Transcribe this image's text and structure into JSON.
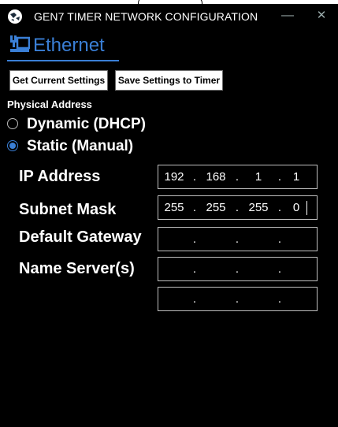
{
  "window": {
    "title": "GEN7 TIMER NETWORK CONFIGURATION",
    "minimize_glyph": "—",
    "close_glyph": "✕"
  },
  "tab": {
    "label": "Ethernet",
    "icon": "ethernet-network-icon"
  },
  "toolbar": {
    "get_label": "Get Current Settings",
    "save_label": "Save Settings to Timer"
  },
  "physical_address": {
    "label": "Physical Address",
    "options": [
      {
        "label": "Dynamic (DHCP)",
        "checked": false
      },
      {
        "label": "Static (Manual)",
        "checked": true
      }
    ]
  },
  "fields": {
    "ip": {
      "label": "IP Address",
      "octets": [
        "192",
        "168",
        "1",
        "1"
      ]
    },
    "subnet": {
      "label": "Subnet Mask",
      "octets": [
        "255",
        "255",
        "255",
        "0"
      ]
    },
    "gateway": {
      "label": "Default Gateway",
      "octets": [
        "",
        "",
        "",
        ""
      ]
    },
    "dns": {
      "label": "Name Server(s)",
      "octets": [
        "",
        "",
        "",
        ""
      ]
    },
    "dns2": {
      "octets": [
        "",
        "",
        "",
        ""
      ]
    }
  },
  "colors": {
    "accent": "#3a7fd6",
    "background": "#000000",
    "text": "#ffffff"
  }
}
